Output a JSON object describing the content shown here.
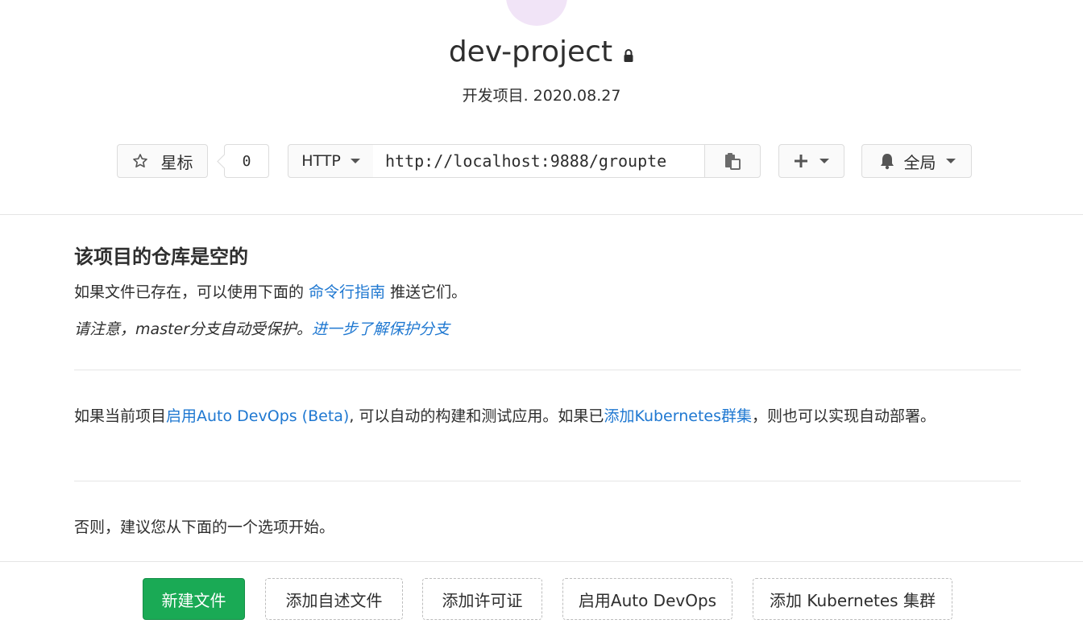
{
  "project": {
    "name": "dev-project",
    "description": "开发项目. 2020.08.27"
  },
  "controls": {
    "star_label": "星标",
    "star_count": "0",
    "protocol": "HTTP",
    "clone_url": "http://localhost:9888/groupte",
    "notification_label": "全局"
  },
  "empty": {
    "title": "该项目的仓库是空的",
    "line1_prefix": "如果文件已存在，可以使用下面的 ",
    "line1_link": "命令行指南",
    "line1_suffix": " 推送它们。",
    "line2_prefix": "请注意，master分支自动受保护。",
    "line2_link": "进一步了解保护分支",
    "devops_prefix": "如果当前项目",
    "devops_link": "启用Auto DevOps (Beta)",
    "devops_middle": ", 可以自动的构建和测试应用。如果已",
    "k8s_link": "添加Kubernetes群集",
    "devops_suffix": "，则也可以实现自动部署。",
    "otherwise": "否则，建议您从下面的一个选项开始。"
  },
  "actions": {
    "new_file": "新建文件",
    "add_readme": "添加自述文件",
    "add_license": "添加许可证",
    "enable_devops": "启用Auto DevOps",
    "add_k8s": "添加 Kubernetes 集群"
  },
  "colors": {
    "link": "#1f78d1",
    "primary_button": "#1aaa55",
    "avatar": "#f1e4f7"
  }
}
